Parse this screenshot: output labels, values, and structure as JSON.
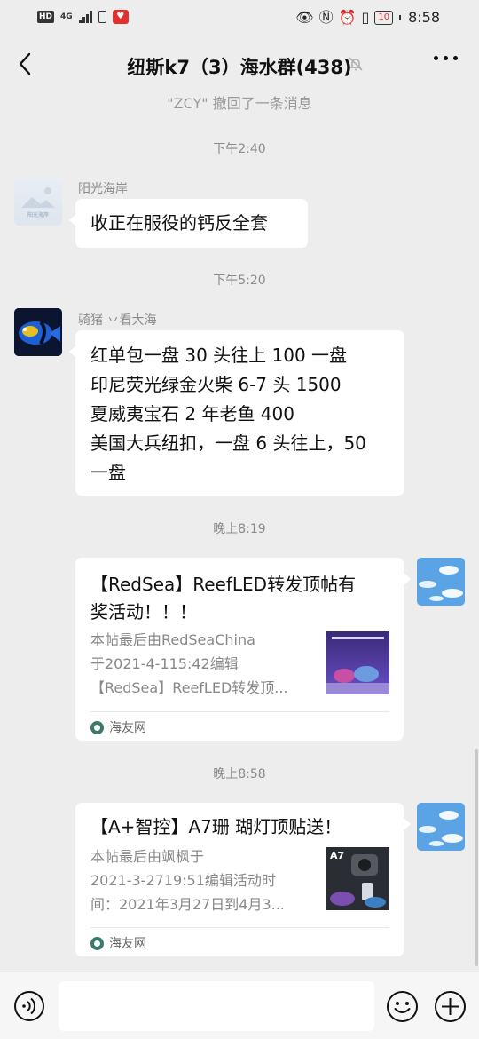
{
  "status_bar": {
    "network_badge": "HD",
    "network_type": "4G",
    "battery_level": "10",
    "time": "8:58"
  },
  "header": {
    "title": "纽斯k7（3）海水群(438)"
  },
  "recall_notice": "\"ZCY\" 撤回了一条消息",
  "messages": [
    {
      "time": "下午2:40",
      "sender": "阳光海岸",
      "avatar_caption": "阳光海岸",
      "text": "收正在服役的钙反全套"
    },
    {
      "time": "下午5:20",
      "sender": "骑猪 丷看大海",
      "lines": [
        "红单包一盘 30 头往上 100 一盘",
        "印尼荧光绿金火柴 6-7 头 1500",
        "夏威夷宝石 2 年老鱼 400",
        "美国大兵纽扣，一盘 6 头往上，50",
        "一盘"
      ]
    }
  ],
  "shared_posts": [
    {
      "time": "晚上8:19",
      "title_lines": [
        "【RedSea】ReefLED转发顶帖有",
        "奖活动！！！"
      ],
      "desc_lines": [
        "本帖最后由RedSeaChina",
        "于2021-4-115:42编辑",
        "【RedSea】ReefLED转发顶..."
      ],
      "source": "海友网"
    },
    {
      "time": "晚上8:58",
      "title_lines": [
        "【A+智控】A7珊 瑚灯顶贴送！"
      ],
      "desc_lines": [
        "本帖最后由飒枫于",
        "2021-3-2719:51编辑活动时",
        "间：2021年3月27日到4月3..."
      ],
      "thumb_label": "A7",
      "source": "海友网"
    }
  ],
  "input": {
    "value": ""
  },
  "colors": {
    "background": "#ededed",
    "bubble": "#ffffff",
    "meta_text": "#8a8a8a",
    "battery_low": "#e0312f"
  }
}
